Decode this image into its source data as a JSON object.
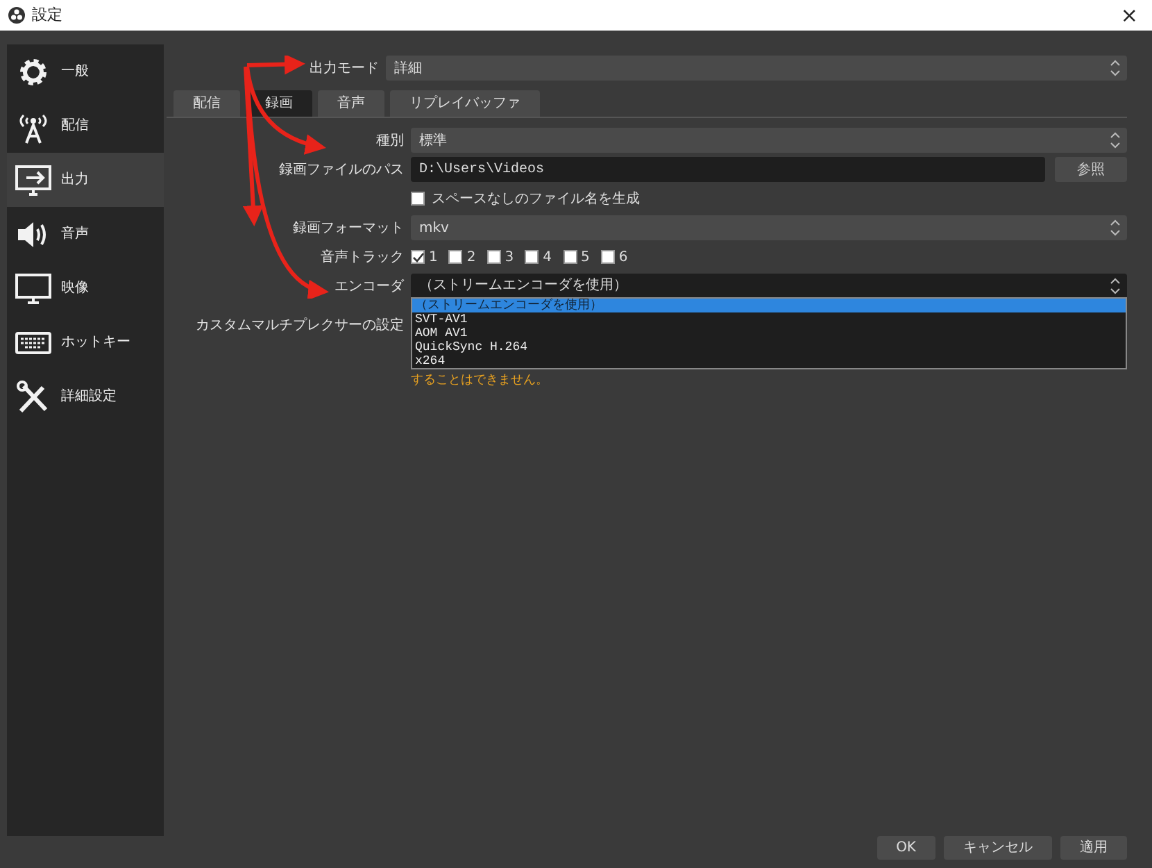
{
  "window": {
    "title": "設定",
    "close": "×"
  },
  "sidebar": {
    "items": [
      {
        "label": "一般",
        "selected": false
      },
      {
        "label": "配信",
        "selected": false
      },
      {
        "label": "出力",
        "selected": true
      },
      {
        "label": "音声",
        "selected": false
      },
      {
        "label": "映像",
        "selected": false
      },
      {
        "label": "ホットキー",
        "selected": false
      },
      {
        "label": "詳細設定",
        "selected": false
      }
    ]
  },
  "output_mode": {
    "label": "出力モード",
    "value": "詳細"
  },
  "tabs": [
    {
      "label": "配信",
      "selected": false
    },
    {
      "label": "録画",
      "selected": true
    },
    {
      "label": "音声",
      "selected": false
    },
    {
      "label": "リプレイバッファ",
      "selected": false
    }
  ],
  "form": [
    {
      "kind": "select",
      "label": "種別",
      "value": "標準"
    },
    {
      "kind": "path",
      "label": "録画ファイルのパス",
      "value": "D:\\Users\\Videos",
      "button": "参照"
    },
    {
      "kind": "checkbox",
      "label": "スペースなしのファイル名を生成",
      "checked": false
    },
    {
      "kind": "select",
      "label": "録画フォーマット",
      "value": "mkv"
    },
    {
      "kind": "tracks",
      "label": "音声トラック",
      "tracks": [
        {
          "label": "1",
          "checked": true
        },
        {
          "label": "2",
          "checked": false
        },
        {
          "label": "3",
          "checked": false
        },
        {
          "label": "4",
          "checked": false
        },
        {
          "label": "5",
          "checked": false
        },
        {
          "label": "6",
          "checked": false
        }
      ]
    },
    {
      "kind": "open-select",
      "label": "エンコーダ",
      "value": "（ストリームエンコーダを使用）",
      "options": [
        {
          "label": "（ストリームエンコーダを使用）",
          "selected": true
        },
        {
          "label": "SVT-AV1",
          "selected": false
        },
        {
          "label": "AOM AV1",
          "selected": false
        },
        {
          "label": "QuickSync H.264",
          "selected": false
        },
        {
          "label": "x264",
          "selected": false
        }
      ]
    },
    {
      "kind": "label",
      "label": "カスタムマルチプレクサーの設定"
    },
    {
      "kind": "warning",
      "label": "することはできません。"
    }
  ],
  "buttons": [
    "OK",
    "キャンセル",
    "適用"
  ]
}
